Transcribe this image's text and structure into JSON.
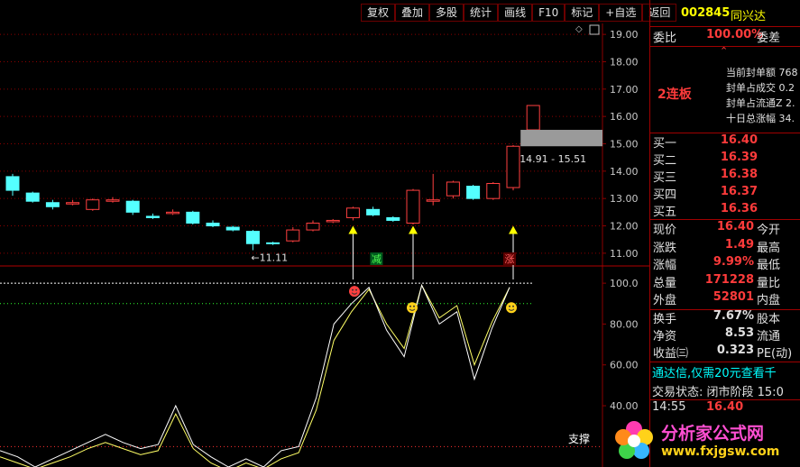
{
  "toolbar": {
    "items": [
      "复权",
      "叠加",
      "多股",
      "统计",
      "画线",
      "F10",
      "标记",
      "+自选",
      "返回"
    ]
  },
  "stock": {
    "code": "002845",
    "name": "同兴达"
  },
  "weibi": {
    "label": "委比",
    "value": "100.00%",
    "label2": "委差",
    "arrow": "⌃"
  },
  "seal": {
    "lianban": "2连板",
    "rows": [
      "当前封单额 768",
      "封单占成交 0.2",
      "封单占流通Z 2.",
      "十日总涨幅 34."
    ]
  },
  "buy": [
    {
      "label": "买一",
      "price": "16.40"
    },
    {
      "label": "买二",
      "price": "16.39"
    },
    {
      "label": "买三",
      "price": "16.38"
    },
    {
      "label": "买四",
      "price": "16.37"
    },
    {
      "label": "买五",
      "price": "16.36"
    }
  ],
  "quote": [
    {
      "label": "现价",
      "value": "16.40",
      "label2": "今开"
    },
    {
      "label": "涨跌",
      "value": "1.49",
      "label2": "最高"
    },
    {
      "label": "涨幅",
      "value": "9.99%",
      "label2": "最低"
    },
    {
      "label": "总量",
      "value": "171228",
      "label2": "量比"
    },
    {
      "label": "外盘",
      "value": "52801",
      "label2": "内盘"
    }
  ],
  "stats": [
    {
      "label": "换手",
      "value": "7.67%",
      "label2": "股本"
    },
    {
      "label": "净资",
      "value": "8.53",
      "label2": "流通"
    },
    {
      "label": "收益㈢",
      "value": "0.323",
      "label2": "PE(动)"
    }
  ],
  "promo": "通达信,仅需20元查看千",
  "trade_status": "交易状态: 闭市阶段 15:0",
  "tick": {
    "time": "14:55",
    "price": "16.40"
  },
  "watermark": {
    "cn": "分析家公式网",
    "url": "www.fxjgsw.com"
  },
  "chart_data": {
    "type": "candlestick",
    "price_axis": {
      "ticks": [
        "19.00",
        "18.00",
        "17.00",
        "16.00",
        "15.00",
        "14.00",
        "13.00",
        "12.00",
        "11.00"
      ],
      "range": [
        10.6,
        19.4
      ]
    },
    "candles": [
      {
        "o": 13.8,
        "c": 13.3,
        "h": 13.9,
        "l": 13.1
      },
      {
        "o": 13.2,
        "c": 12.9,
        "h": 13.25,
        "l": 12.85
      },
      {
        "o": 12.85,
        "c": 12.7,
        "h": 12.95,
        "l": 12.6
      },
      {
        "o": 12.8,
        "c": 12.85,
        "h": 12.95,
        "l": 12.75
      },
      {
        "o": 12.6,
        "c": 12.95,
        "h": 13.0,
        "l": 12.55
      },
      {
        "o": 12.9,
        "c": 12.95,
        "h": 13.05,
        "l": 12.85
      },
      {
        "o": 12.9,
        "c": 12.5,
        "h": 12.95,
        "l": 12.4
      },
      {
        "o": 12.35,
        "c": 12.3,
        "h": 12.45,
        "l": 12.25
      },
      {
        "o": 12.45,
        "c": 12.5,
        "h": 12.6,
        "l": 12.4
      },
      {
        "o": 12.5,
        "c": 12.1,
        "h": 12.55,
        "l": 12.05
      },
      {
        "o": 12.1,
        "c": 12.0,
        "h": 12.2,
        "l": 11.95
      },
      {
        "o": 11.95,
        "c": 11.85,
        "h": 12.0,
        "l": 11.8
      },
      {
        "o": 11.8,
        "c": 11.35,
        "h": 11.85,
        "l": 11.11
      },
      {
        "o": 11.38,
        "c": 11.35,
        "h": 11.42,
        "l": 11.3
      },
      {
        "o": 11.45,
        "c": 11.85,
        "h": 11.95,
        "l": 11.4
      },
      {
        "o": 11.85,
        "c": 12.1,
        "h": 12.2,
        "l": 11.8
      },
      {
        "o": 12.15,
        "c": 12.2,
        "h": 12.25,
        "l": 12.1
      },
      {
        "o": 12.3,
        "c": 12.65,
        "h": 12.7,
        "l": 12.2
      },
      {
        "o": 12.6,
        "c": 12.4,
        "h": 12.7,
        "l": 12.35
      },
      {
        "o": 12.3,
        "c": 12.2,
        "h": 12.35,
        "l": 12.15
      },
      {
        "o": 12.1,
        "c": 13.3,
        "h": 13.35,
        "l": 12.05
      },
      {
        "o": 12.9,
        "c": 12.95,
        "h": 13.9,
        "l": 12.75
      },
      {
        "o": 13.1,
        "c": 13.6,
        "h": 13.65,
        "l": 13.0
      },
      {
        "o": 13.45,
        "c": 13.0,
        "h": 13.5,
        "l": 12.95
      },
      {
        "o": 13.0,
        "c": 13.55,
        "h": 13.6,
        "l": 12.95
      },
      {
        "o": 13.4,
        "c": 14.91,
        "h": 14.95,
        "l": 13.3
      },
      {
        "o": 15.51,
        "c": 16.4,
        "h": 16.4,
        "l": 15.51
      }
    ],
    "min_label": "←11.11",
    "gap_label": "14.91 - 15.51",
    "arrow_labels": [
      "减",
      "涨"
    ],
    "osc_axis": {
      "ticks": [
        "100.0",
        "80.00",
        "60.00",
        "40.00"
      ],
      "range": [
        10,
        108
      ]
    },
    "osc_series1": [
      18,
      15,
      10,
      14,
      18,
      22,
      26,
      22,
      19,
      21,
      40,
      21,
      15,
      10,
      14,
      10,
      18,
      20,
      44,
      80,
      90,
      98,
      77,
      64,
      99,
      80,
      86,
      53,
      78,
      98
    ],
    "osc_series2": [
      15,
      12,
      9,
      12,
      15,
      19,
      22,
      19,
      16,
      18,
      36,
      19,
      12,
      8,
      12,
      9,
      14,
      17,
      38,
      72,
      86,
      97,
      80,
      68,
      99,
      83,
      89,
      60,
      81,
      98
    ],
    "osc_label": "支撑",
    "colors": {
      "up": "#ff4040",
      "down": "#54ffff",
      "grid": "#8c0000",
      "axis_text": "#c8c8c8",
      "line1": "#ffffff",
      "line2": "#ffff66"
    }
  }
}
